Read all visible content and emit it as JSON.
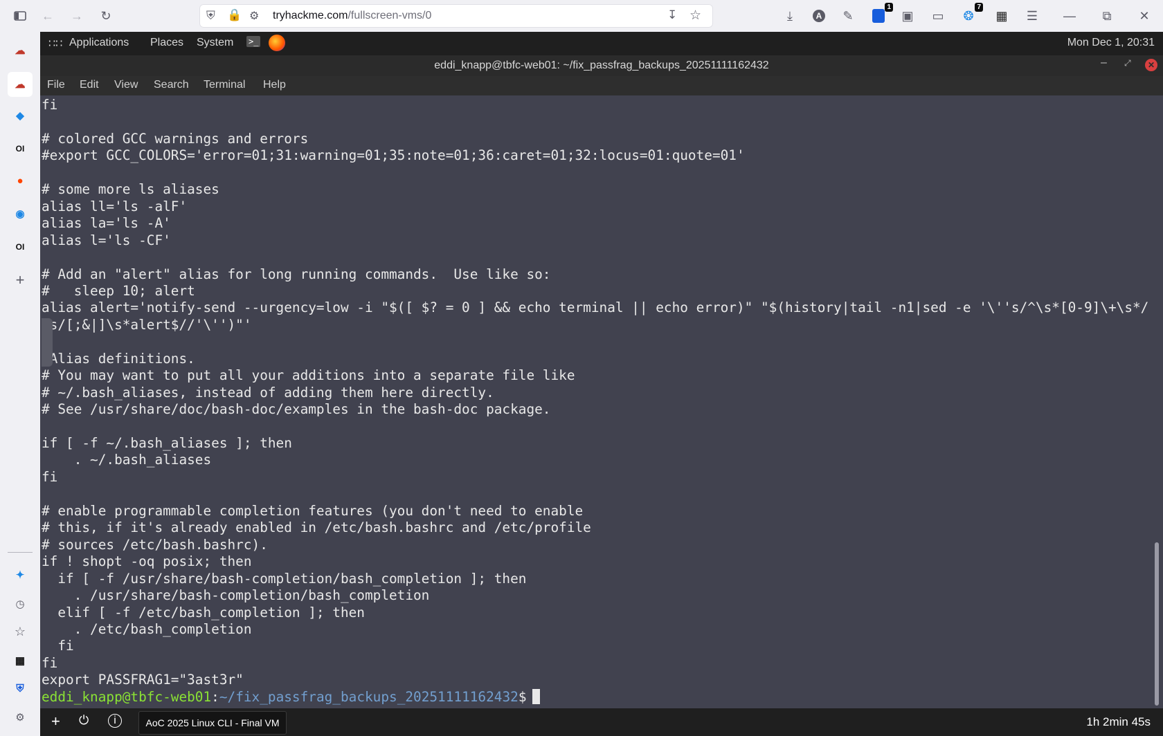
{
  "browser": {
    "url_host": "tryhackme.com",
    "url_path": "/fullscreen-vms/0",
    "ext_badge_1": "1",
    "ext_badge_2": "7"
  },
  "gnome_panel": {
    "applications": "Applications",
    "places": "Places",
    "system": "System",
    "clock": "Mon Dec 1, 20:31"
  },
  "terminal_window": {
    "title": "eddi_knapp@tbfc-web01: ~/fix_passfrag_backups_20251111162432",
    "menu": [
      "File",
      "Edit",
      "View",
      "Search",
      "Terminal",
      "Help"
    ]
  },
  "terminal": {
    "lines": [
      "fi",
      "",
      "# colored GCC warnings and errors",
      "#export GCC_COLORS='error=01;31:warning=01;35:note=01;36:caret=01;32:locus=01:quote=01'",
      "",
      "# some more ls aliases",
      "alias ll='ls -alF'",
      "alias la='ls -A'",
      "alias l='ls -CF'",
      "",
      "# Add an \"alert\" alias for long running commands.  Use like so:",
      "#   sleep 10; alert",
      "alias alert='notify-send --urgency=low -i \"$([ $? = 0 ] && echo terminal || echo error)\" \"$(history|tail -n1|sed -e '\\''s/^\\s*[0-9]\\+\\s*/",
      ";s/[;&|]\\s*alert$//'\\'')\"'",
      "",
      " Alias definitions.",
      "# You may want to put all your additions into a separate file like",
      "# ~/.bash_aliases, instead of adding them here directly.",
      "# See /usr/share/doc/bash-doc/examples in the bash-doc package.",
      "",
      "if [ -f ~/.bash_aliases ]; then",
      "    . ~/.bash_aliases",
      "fi",
      "",
      "# enable programmable completion features (you don't need to enable",
      "# this, if it's already enabled in /etc/bash.bashrc and /etc/profile",
      "# sources /etc/bash.bashrc).",
      "if ! shopt -oq posix; then",
      "  if [ -f /usr/share/bash-completion/bash_completion ]; then",
      "    . /usr/share/bash-completion/bash_completion",
      "  elif [ -f /etc/bash_completion ]; then",
      "    . /etc/bash_completion",
      "  fi",
      "fi",
      "export PASSFRAG1=\"3ast3r\""
    ],
    "prompt_user": "eddi_knapp@tbfc-web01",
    "prompt_sep": ":",
    "prompt_path": "~/fix_passfrag_backups_20251111162432",
    "prompt_end": "$"
  },
  "taskbar": {
    "vm_name": "AoC 2025 Linux CLI - Final VM",
    "timer": "1h 2min 45s"
  },
  "colors": {
    "terminal_bg": "#41424f",
    "prompt_user": "#8ae234",
    "prompt_path": "#729fcf"
  }
}
